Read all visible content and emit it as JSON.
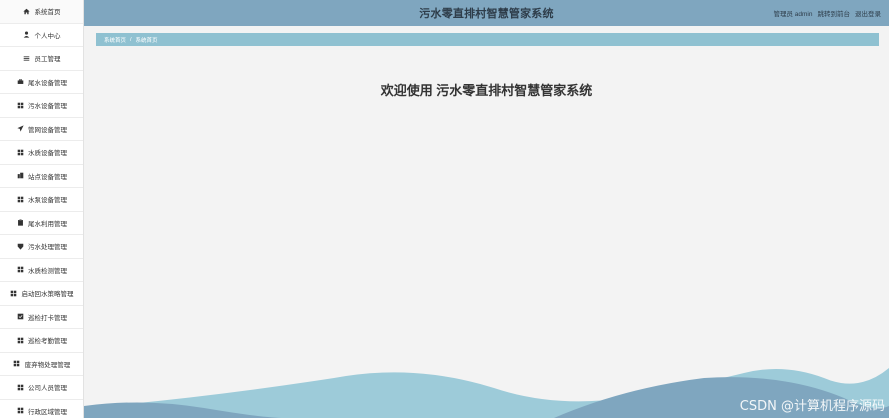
{
  "sidebar": {
    "items": [
      {
        "label": "系统首页",
        "icon": "home-icon"
      },
      {
        "label": "个人中心",
        "icon": "user-icon"
      },
      {
        "label": "员工管理",
        "icon": "list-icon"
      },
      {
        "label": "尾水设备管理",
        "icon": "briefcase-icon"
      },
      {
        "label": "污水设备管理",
        "icon": "grid-icon"
      },
      {
        "label": "管网设备管理",
        "icon": "send-icon"
      },
      {
        "label": "水质设备管理",
        "icon": "grid-icon"
      },
      {
        "label": "站点设备管理",
        "icon": "building-icon"
      },
      {
        "label": "水泵设备管理",
        "icon": "grid-icon"
      },
      {
        "label": "尾水利用管理",
        "icon": "clipboard-icon"
      },
      {
        "label": "污水处理管理",
        "icon": "shield-icon"
      },
      {
        "label": "水质检测管理",
        "icon": "grid-icon"
      },
      {
        "label": "启动回水策略管理",
        "icon": "grid-icon"
      },
      {
        "label": "巡检打卡管理",
        "icon": "check-square-icon"
      },
      {
        "label": "巡检考勤管理",
        "icon": "grid-icon"
      },
      {
        "label": "废弃物处理管理",
        "icon": "grid-icon"
      },
      {
        "label": "公司人员管理",
        "icon": "grid-icon"
      },
      {
        "label": "行政区域管理",
        "icon": "grid-icon"
      }
    ]
  },
  "header": {
    "title": "污水零直排村智慧管家系统",
    "role": "管理员 admin",
    "frontend_link": "跳转到前台",
    "logout": "退出登录"
  },
  "breadcrumb": {
    "home": "系统首页",
    "separator": "/",
    "current": "系统首页"
  },
  "welcome": "欢迎使用 污水零直排村智慧管家系统",
  "watermark": "CSDN @计算机程序源码",
  "colors": {
    "header_bg": "#7fa6bf",
    "breadcrumb_bg": "#8fc1d1",
    "wave_light": "#9dcbd9",
    "wave_dark": "#7fa6bf"
  }
}
